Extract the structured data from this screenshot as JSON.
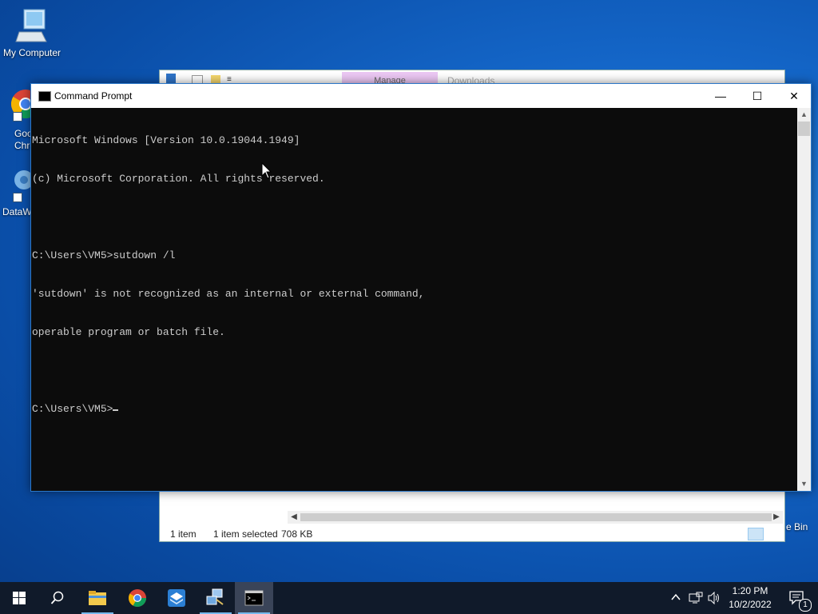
{
  "desktop": {
    "icons": [
      {
        "label": "My Computer"
      },
      {
        "label": "Goo Chro"
      },
      {
        "label": "DataW"
      },
      {
        "label": "e Bin"
      }
    ]
  },
  "explorer": {
    "manage_tab": "Manage",
    "title": "Downloads",
    "status_items": "1 item",
    "status_selected": "1 item selected",
    "status_size": "708 KB"
  },
  "cmd": {
    "title": "Command Prompt",
    "lines": [
      "Microsoft Windows [Version 10.0.19044.1949]",
      "(c) Microsoft Corporation. All rights reserved.",
      "",
      "C:\\Users\\VM5>sutdown /l",
      "'sutdown' is not recognized as an internal or external command,",
      "operable program or batch file.",
      "",
      "C:\\Users\\VM5>"
    ],
    "controls": {
      "minimize": "—",
      "maximize": "☐",
      "close": "✕"
    }
  },
  "taskbar": {
    "items": [
      "start-icon",
      "search-icon",
      "file-explorer-icon",
      "chrome-icon",
      "app-icon",
      "network-app-icon",
      "command-prompt-icon"
    ],
    "clock_time": "1:20 PM",
    "clock_date": "10/2/2022",
    "notification_count": "1"
  },
  "colors": {
    "accent": "#2b78c9",
    "console_bg": "#0c0c0c",
    "console_fg": "#cccccc"
  }
}
